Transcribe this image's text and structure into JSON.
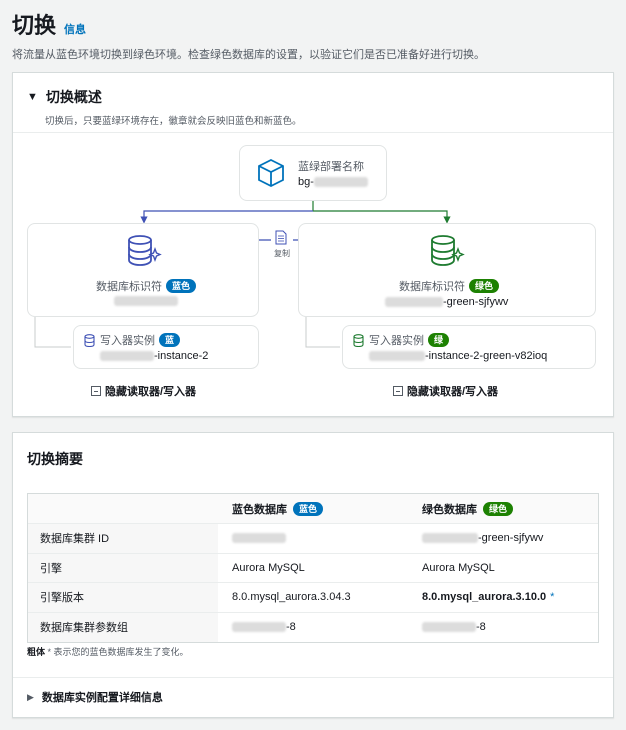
{
  "header": {
    "title": "切换",
    "info_link": "信息",
    "description": "将流量从蓝色环境切换到绿色环境。检查绿色数据库的设置，以验证它们是否已准备好进行切换。"
  },
  "overview": {
    "title": "切换概述",
    "subtitle": "切换后，只要蓝绿环境存在，徽章就会反映旧蓝色和新蓝色。",
    "deployment": {
      "label": "蓝绿部署名称",
      "value_prefix": "bg-"
    },
    "copy_label": "复制",
    "blue": {
      "db_label": "数据库标识符",
      "badge": "蓝色",
      "instance_label": "写入器实例",
      "instance_badge": "蓝",
      "instance_suffix": "-instance-2",
      "toggle": "隐藏读取器/写入器"
    },
    "green": {
      "db_label": "数据库标识符",
      "badge": "绿色",
      "db_suffix": "-green-sjfywv",
      "instance_label": "写入器实例",
      "instance_badge": "绿",
      "instance_suffix": "-instance-2-green-v82ioq",
      "toggle": "隐藏读取器/写入器"
    }
  },
  "summary": {
    "title": "切换摘要",
    "columns": {
      "blue_db": "蓝色数据库",
      "blue_badge": "蓝色",
      "green_db": "绿色数据库",
      "green_badge": "绿色"
    },
    "rows": [
      {
        "label": "数据库集群 ID",
        "blue": "",
        "green": "-green-sjfywv"
      },
      {
        "label": "引擎",
        "blue": "Aurora MySQL",
        "green": "Aurora MySQL"
      },
      {
        "label": "引擎版本",
        "blue": "8.0.mysql_aurora.3.04.3",
        "green": "8.0.mysql_aurora.3.10.0",
        "green_star": "*"
      },
      {
        "label": "数据库集群参数组",
        "blue": "-8",
        "green": "-8"
      }
    ],
    "note_bold": "粗体",
    "note_text": " * 表示您的蓝色数据库发生了变化。",
    "expander": "数据库实例配置详细信息"
  },
  "colors": {
    "blue": "#0073bb",
    "green": "#1d8102",
    "arrow_blue": "#3f51b5",
    "arrow_green": "#1e7b30"
  }
}
